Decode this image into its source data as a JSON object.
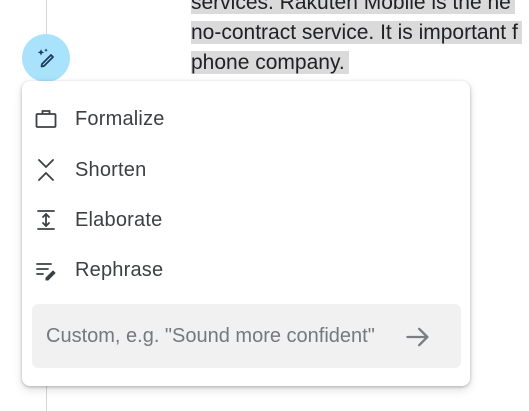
{
  "document": {
    "lines": [
      "services. Rakuten Mobile is the ne",
      "no-contract service. It is important f",
      "phone company."
    ]
  },
  "menu": {
    "items": [
      {
        "label": "Formalize",
        "icon": "briefcase-icon"
      },
      {
        "label": "Shorten",
        "icon": "collapse-icon"
      },
      {
        "label": "Elaborate",
        "icon": "expand-icon"
      },
      {
        "label": "Rephrase",
        "icon": "rephrase-icon"
      }
    ],
    "custom": {
      "placeholder": "Custom, e.g. \"Sound more confident\"",
      "value": ""
    }
  },
  "fab": {
    "icon": "magic-pen-icon"
  },
  "colors": {
    "fab_bg": "#a8e3fb",
    "highlight": "#dadada",
    "input_bg": "#f1f1f1"
  }
}
